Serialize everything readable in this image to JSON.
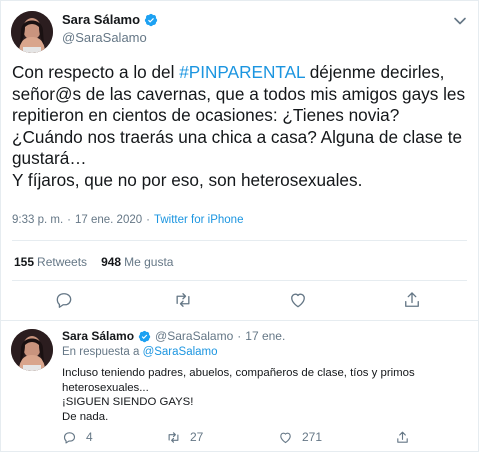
{
  "colors": {
    "accent": "#1b95e0",
    "text": "#14171a",
    "muted": "#657786",
    "border": "#e6ecf0"
  },
  "main_tweet": {
    "display_name": "Sara Sálamo",
    "handle": "@SaraSalamo",
    "text_before_hashtag": "Con respecto a lo del ",
    "hashtag": "#PINPARENTAL",
    "text_after_hashtag": " déjenme decirles, señor@s de las cavernas, que a todos mis amigos gays les repitieron en cientos de ocasiones: ¿Tienes novia? ¿Cuándo nos traerás una chica a casa? Alguna de clase te gustará…\nY fíjaros, que no por eso, son heterosexuales.",
    "time": "9:33 p. m.",
    "meta_sep": "·",
    "date": "17 ene. 2020",
    "source": "Twitter for iPhone",
    "retweets_count": "155",
    "retweets_label": "Retweets",
    "likes_count": "948",
    "likes_label": "Me gusta",
    "icons": [
      "reply-icon",
      "retweet-icon",
      "heart-icon",
      "share-icon"
    ]
  },
  "reply_tweet": {
    "display_name": "Sara Sálamo",
    "handle": "@SaraSalamo",
    "sep": "·",
    "date": "17 ene.",
    "in_reply_prefix": "En respuesta a",
    "in_reply_handle": "@SaraSalamo",
    "lines": [
      "Incluso teniendo padres, abuelos, compañeros de clase, tíos y primos",
      "heterosexuales...",
      "¡SIGUEN SIENDO GAYS!",
      "De nada."
    ],
    "reply_count": "4",
    "retweet_count": "27",
    "like_count": "271"
  }
}
